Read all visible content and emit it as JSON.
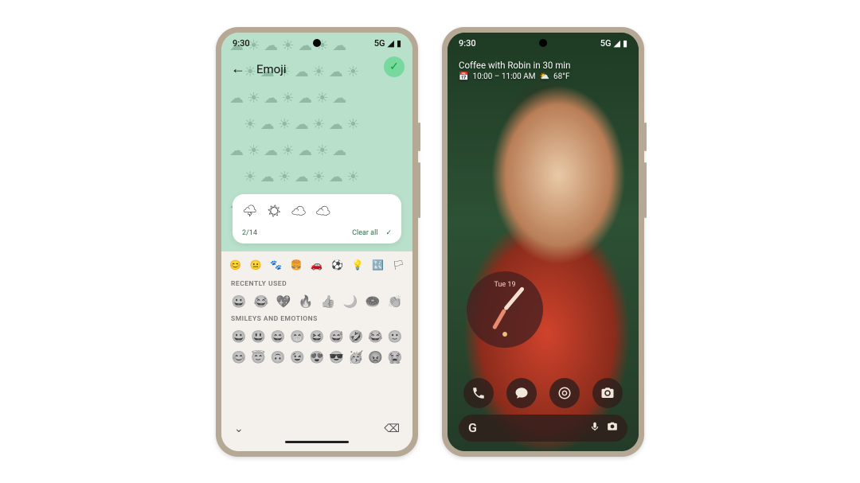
{
  "statusbar": {
    "time": "9:30",
    "network": "5G"
  },
  "left": {
    "title": "Emoji",
    "done_icon": "✓",
    "compose": {
      "emojis": "🌩  ☀  ☁  ☁",
      "counter": "2/14",
      "clear_label": "Clear all"
    },
    "tabs": [
      "😊",
      "😐",
      "🐾",
      "🍔",
      "🚗",
      "⚽",
      "💡",
      "🔣",
      "🏳"
    ],
    "section1": "RECENTLY USED",
    "recent": [
      "😀",
      "😂",
      "💖",
      "🔥",
      "👍",
      "🌙",
      "🍩",
      "👏"
    ],
    "section2": "SMILEYS AND EMOTIONS",
    "smileys_r1": [
      "😀",
      "😃",
      "😄",
      "😁",
      "😆",
      "😅",
      "🤣",
      "😂",
      "🙂"
    ],
    "smileys_r2": [
      "😊",
      "😇",
      "🙃",
      "😉",
      "😍",
      "😎",
      "🥳",
      "😡",
      "😭"
    ]
  },
  "right": {
    "glance_title": "Coffee with Robin in 30 min",
    "glance_time": "10:00 – 11:00 AM",
    "glance_temp": "68°F",
    "clock_date": "Tue 19",
    "dock": {
      "phone": "phone-icon",
      "messages": "chat-icon",
      "browser": "browser-icon",
      "camera": "camera-icon"
    },
    "search": {
      "logo": "G",
      "mic": "mic-icon",
      "lens": "lens-icon"
    }
  }
}
